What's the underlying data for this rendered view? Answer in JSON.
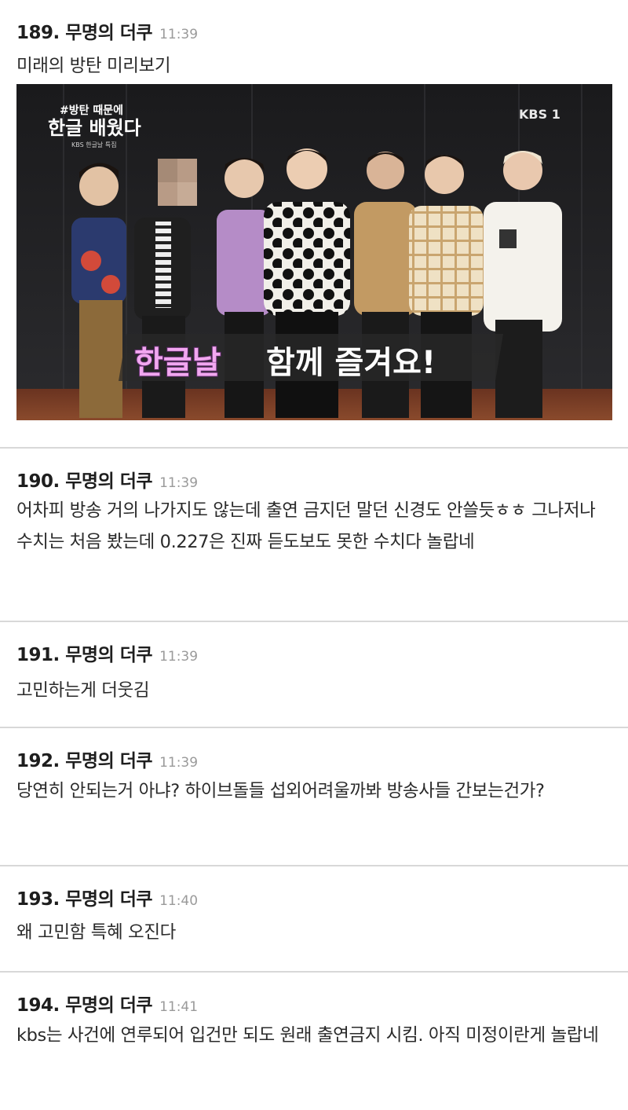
{
  "comments": [
    {
      "author": "189. 무명의 더쿠",
      "time": "11:39",
      "text": "미래의 방탄 미리보기",
      "image": {
        "banner_line1": "#방탄 때문에",
        "banner_line2": "한글 배웠다",
        "banner_sub": "KBS 한글날 특집",
        "channel": "KBS 1",
        "caption_pink": "한글날",
        "caption_white": "함께 즐겨요!"
      }
    },
    {
      "author": "190. 무명의 더쿠",
      "time": "11:39",
      "text": "어차피 방송 거의 나가지도 않는데 출연 금지던 말던 신경도 안쓸듯ㅎㅎ 그나저나 수치는 처음 봤는데 0.227은 진짜 듣도보도 못한 수치다 놀랍네"
    },
    {
      "author": "191. 무명의 더쿠",
      "time": "11:39",
      "text": "고민하는게 더웃김"
    },
    {
      "author": "192. 무명의 더쿠",
      "time": "11:39",
      "text": "당연히 안되는거 아냐? 하이브돌들 섭외어려울까봐 방송사들 간보는건가?"
    },
    {
      "author": "193. 무명의 더쿠",
      "time": "11:40",
      "text": "왜 고민함 특혜 오진다"
    },
    {
      "author": "194. 무명의 더쿠",
      "time": "11:41",
      "text": "kbs는 사건에 연루되어 입건만 되도 원래 출연금지 시킴. 아직 미정이란게 놀랍네"
    }
  ]
}
